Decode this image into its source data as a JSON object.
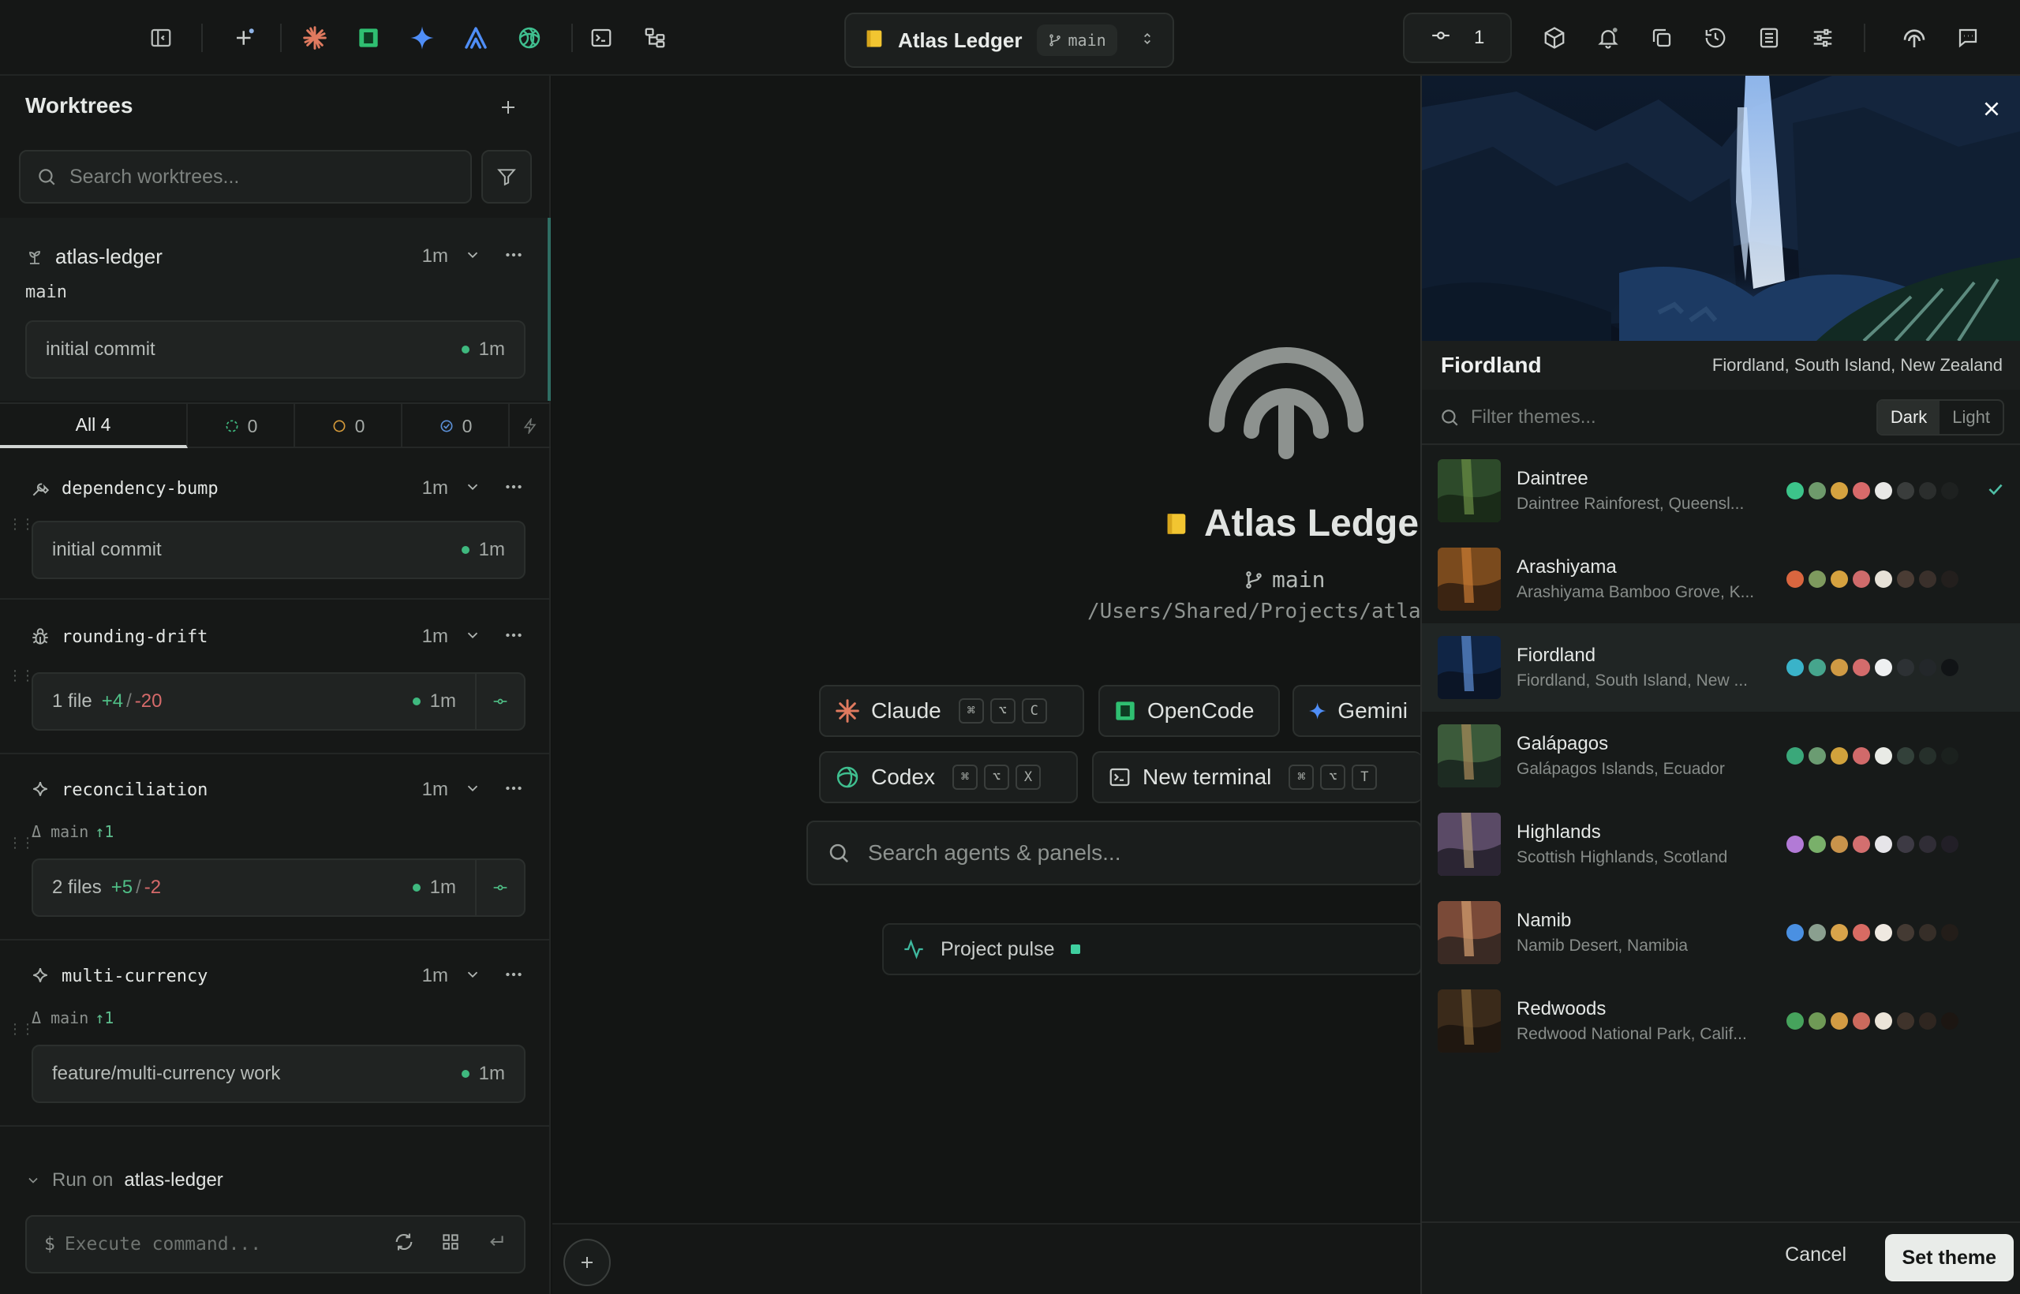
{
  "topbar": {
    "project_name": "Atlas Ledger",
    "branch": "main",
    "port_count": "1",
    "icons": [
      "sidebar-toggle-icon",
      "new-agent-icon",
      "claude-icon",
      "opencode-icon",
      "gemini-icon",
      "amp-icon",
      "codex-icon",
      "terminal-icon",
      "tree-icon",
      "port-icon",
      "package-icon",
      "bell-icon",
      "copy-icon",
      "history-icon",
      "notes-icon",
      "sliders-icon",
      "logo-icon",
      "chat-icon"
    ]
  },
  "sidebar": {
    "title": "Worktrees",
    "search_placeholder": "Search worktrees...",
    "active": {
      "name": "atlas-ledger",
      "time": "1m",
      "branch": "main",
      "commit": "initial commit",
      "commit_time": "1m"
    },
    "tabs": [
      {
        "label": "All 4"
      },
      {
        "label": "0",
        "color": "#3fb97f"
      },
      {
        "label": "0",
        "color": "#d49a3a"
      },
      {
        "label": "0",
        "color": "#5b8fd6"
      }
    ],
    "items": [
      {
        "name": "dependency-bump",
        "time": "1m",
        "commit": "initial commit",
        "commit_time": "1m"
      },
      {
        "name": "rounding-drift",
        "time": "1m",
        "files": "1 file",
        "add": "+4",
        "sep": "/",
        "del": "-20",
        "commit_time": "1m"
      },
      {
        "name": "reconciliation",
        "time": "1m",
        "sub_base": "Δ main",
        "sub_ahead": "↑1",
        "files": "2 files",
        "add": "+5",
        "sep": "/",
        "del": "-2",
        "commit_time": "1m"
      },
      {
        "name": "multi-currency",
        "time": "1m",
        "sub_base": "Δ main",
        "sub_ahead": "↑1",
        "commit": "feature/multi-currency work",
        "commit_time": "1m"
      }
    ],
    "run_on_label": "Run on",
    "run_on_target": "atlas-ledger",
    "cmd_prefix": "$",
    "cmd_placeholder": "Execute command..."
  },
  "center": {
    "project": "Atlas Ledger",
    "branch": "main",
    "path": "/Users/Shared/Projects/atlas-l",
    "agents": [
      {
        "label": "Claude",
        "keys": [
          "⌘",
          "⌥",
          "C"
        ]
      },
      {
        "label": "OpenCode",
        "keys": []
      },
      {
        "label": "Gemini",
        "keys": []
      },
      {
        "label": "Codex",
        "keys": [
          "⌘",
          "⌥",
          "X"
        ]
      },
      {
        "label": "New terminal",
        "keys": [
          "⌘",
          "⌥",
          "T"
        ]
      }
    ],
    "search_placeholder": "Search agents & panels...",
    "pulse_label": "Project pulse"
  },
  "panel": {
    "hero_title": "Fiordland",
    "hero_subtitle": "Fiordland, South Island, New Zealand",
    "filter_placeholder": "Filter themes...",
    "mode_dark": "Dark",
    "mode_light": "Light",
    "themes": [
      {
        "name": "Daintree",
        "sub": "Daintree Rainforest, Queensl...",
        "colors": [
          "#3cc48a",
          "#6e9a6b",
          "#d5a23f",
          "#d86a6a",
          "#e8e8e6",
          "#3a3d3c",
          "#2b2e2d",
          "#1e2120"
        ],
        "checked": true
      },
      {
        "name": "Arashiyama",
        "sub": "Arashiyama Bamboo Grove, K...",
        "colors": [
          "#d9663f",
          "#7e9a5e",
          "#d6a23f",
          "#cf6b6b",
          "#e7e2d8",
          "#4a3c34",
          "#3a302b",
          "#231f1d"
        ]
      },
      {
        "name": "Fiordland",
        "sub": "Fiordland, South Island, New ...",
        "colors": [
          "#3ab3c9",
          "#46a58d",
          "#cf9a44",
          "#d46c6c",
          "#eef0f1",
          "#2d3134",
          "#23272a",
          "#111416"
        ]
      },
      {
        "name": "Galápagos",
        "sub": "Galápagos Islands, Ecuador",
        "colors": [
          "#3aa87a",
          "#6b9c72",
          "#d1a23c",
          "#d16a6a",
          "#e9ebe6",
          "#33413a",
          "#26302b",
          "#1b211e"
        ]
      },
      {
        "name": "Highlands",
        "sub": "Scottish Highlands, Scotland",
        "colors": [
          "#b27ad6",
          "#79b06a",
          "#c8934b",
          "#d36f6f",
          "#e6e5e9",
          "#3d3a44",
          "#302d36",
          "#221f27"
        ]
      },
      {
        "name": "Namib",
        "sub": "Namib Desert, Namibia",
        "colors": [
          "#4a90e2",
          "#8a9f8f",
          "#d8a34a",
          "#d86b63",
          "#efe9e1",
          "#443a33",
          "#362e28",
          "#231d19"
        ]
      },
      {
        "name": "Redwoods",
        "sub": "Redwood National Park, Calif...",
        "colors": [
          "#46a35c",
          "#6f9a56",
          "#d39b43",
          "#cc6a5d",
          "#ebe4d8",
          "#3f332b",
          "#2f2620",
          "#1c1612"
        ]
      }
    ],
    "cancel_label": "Cancel",
    "set_label": "Set theme"
  }
}
